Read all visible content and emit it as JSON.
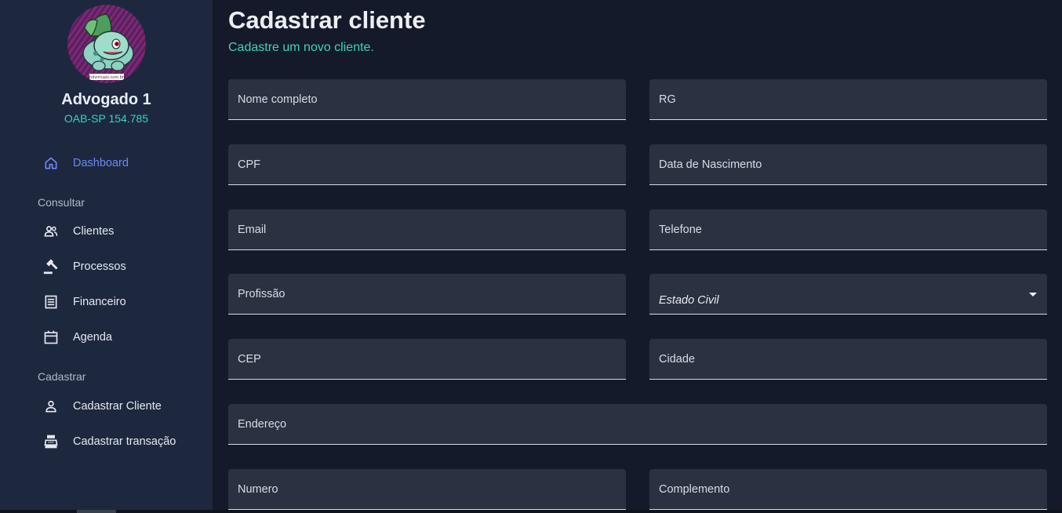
{
  "profile": {
    "name": "Advogado 1",
    "oab": "OAB-SP 154.785",
    "avatar_caption": "ndvirtuais.com.br"
  },
  "nav": {
    "dashboard": "Dashboard",
    "consultar_title": "Consultar",
    "clientes": "Clientes",
    "processos": "Processos",
    "financeiro": "Financeiro",
    "agenda": "Agenda",
    "cadastrar_title": "Cadastrar",
    "cadastrar_cliente": "Cadastrar Cliente",
    "cadastrar_transacao": "Cadastrar transação"
  },
  "page": {
    "title": "Cadastrar cliente",
    "subtitle": "Cadastre um novo cliente."
  },
  "form": {
    "nome": "Nome completo",
    "rg": "RG",
    "cpf": "CPF",
    "nascimento": "Data de Nascimento",
    "email": "Email",
    "telefone": "Telefone",
    "profissao": "Profissão",
    "estado_civil": "Estado Civil",
    "cep": "CEP",
    "cidade": "Cidade",
    "endereco": "Endereço",
    "numero": "Numero",
    "complemento": "Complemento"
  },
  "colors": {
    "accent_active": "#6f87f5",
    "accent_teal": "#3fd3b4",
    "sidebar_bg": "#1d283f",
    "main_bg": "#141a29",
    "field_bg": "#2a3140"
  },
  "icons": {
    "dashboard": "home-icon",
    "clientes": "people-icon",
    "processos": "gavel-icon",
    "financeiro": "receipt-icon",
    "agenda": "calendar-icon",
    "cadastrar_cliente": "person-icon",
    "cadastrar_transacao": "cash-register-icon"
  }
}
